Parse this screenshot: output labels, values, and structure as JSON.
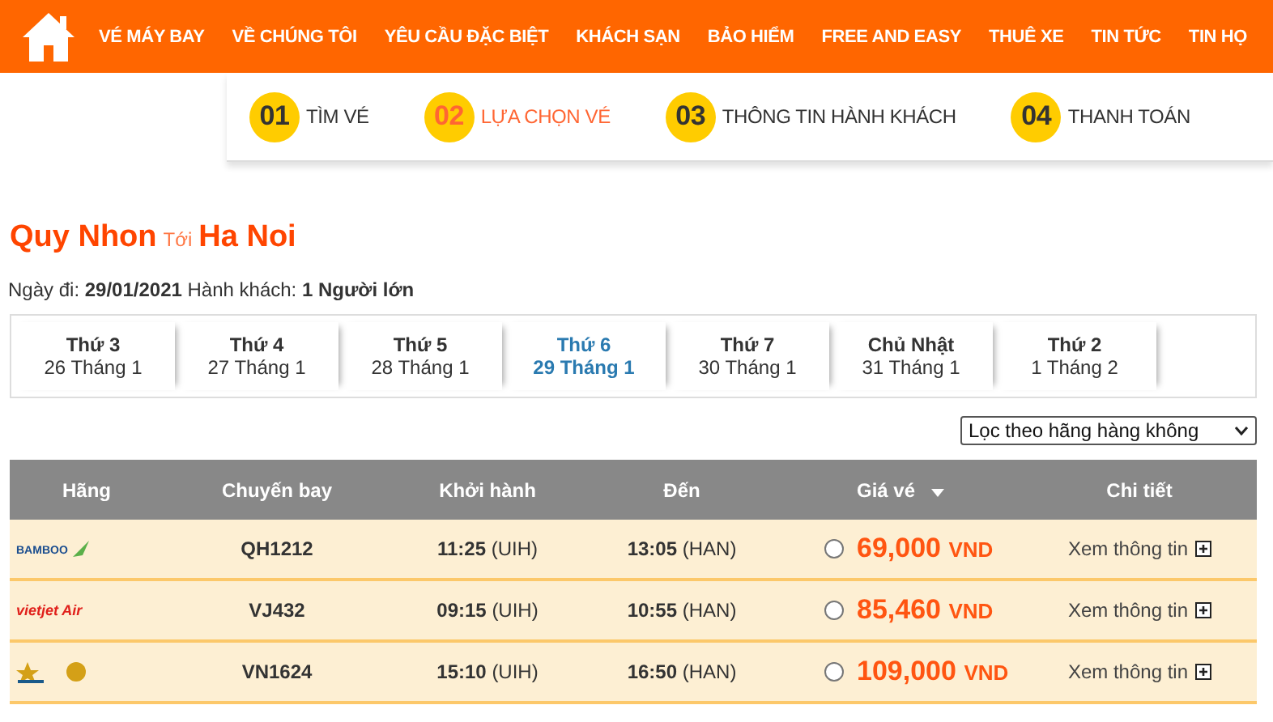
{
  "nav": {
    "items": [
      "VÉ MÁY BAY",
      "VỀ CHÚNG TÔI",
      "YÊU CẦU ĐẶC BIỆT",
      "KHÁCH SẠN",
      "BẢO HIỂM",
      "FREE AND EASY",
      "THUÊ XE",
      "TIN TỨC",
      "TIN HỌ"
    ]
  },
  "steps": [
    {
      "number": "01",
      "label": "TÌM VÉ",
      "selected": false
    },
    {
      "number": "02",
      "label": "LỰA CHỌN VÉ",
      "selected": true
    },
    {
      "number": "03",
      "label": "THÔNG TIN HÀNH KHÁCH",
      "selected": false
    },
    {
      "number": "04",
      "label": "THANH TOÁN",
      "selected": false
    }
  ],
  "route": {
    "from": "Quy Nhon",
    "connector": "Tới",
    "to": "Ha Noi"
  },
  "info": "Ngày đi: **29/01/2021** Hành khách: **1 Người lớn**",
  "dates": [
    {
      "day": "Thứ 3",
      "date": "26 Tháng 1",
      "selected": false
    },
    {
      "day": "Thứ 4",
      "date": "27 Tháng 1",
      "selected": false
    },
    {
      "day": "Thứ 5",
      "date": "28 Tháng 1",
      "selected": false
    },
    {
      "day": "Thứ 6",
      "date": "29 Tháng 1",
      "selected": true
    },
    {
      "day": "Thứ 7",
      "date": "30 Tháng 1",
      "selected": false
    },
    {
      "day": "Chủ Nhật",
      "date": "31 Tháng 1",
      "selected": false
    },
    {
      "day": "Thứ 2",
      "date": "1 Tháng 2",
      "selected": false
    }
  ],
  "filter": {
    "value": "Lọc theo hãng hàng không"
  },
  "table": {
    "columns": [
      "Hãng",
      "Chuyến bay",
      "Khởi hành",
      "Đến",
      "Giá vé",
      "Chi tiết"
    ],
    "rows": [
      {
        "kind": "bamboo",
        "airline_logo": "BAMBOO",
        "flight": "QH1212",
        "depart_time": "11:25",
        "depart_code": "(UIH)",
        "arrive_time": "13:05",
        "arrive_code": "(HAN)",
        "price": "69,000",
        "currency": "VND",
        "selected": false,
        "detail": "Xem thông tin"
      },
      {
        "kind": "vietjet",
        "airline_logo": "vietjet Air",
        "flight": "VJ432",
        "depart_time": "09:15",
        "depart_code": "(UIH)",
        "arrive_time": "10:55",
        "arrive_code": "(HAN)",
        "price": "85,460",
        "currency": "VND",
        "selected": false,
        "detail": "Xem thông tin"
      },
      {
        "kind": "vietnam",
        "flight": "VN1624",
        "depart_time": "15:10",
        "depart_code": "(UIH)",
        "arrive_time": "16:50",
        "arrive_code": "(HAN)",
        "price": "109,000",
        "currency": "VND",
        "selected": false,
        "detail": "Xem thông tin"
      }
    ]
  }
}
